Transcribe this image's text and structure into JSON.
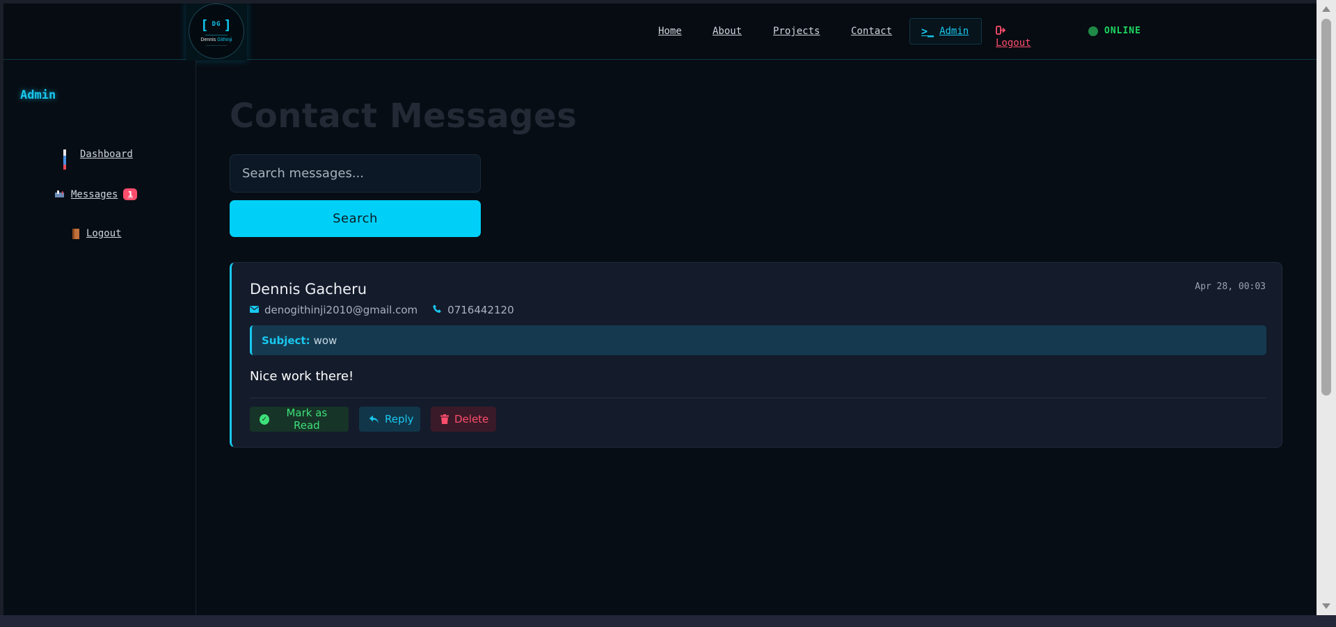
{
  "logo": {
    "initials": "DG",
    "name_first": "Dennis",
    "name_last": "Githinji"
  },
  "nav": {
    "home": "Home",
    "about": "About",
    "projects": "Projects",
    "contact": "Contact",
    "admin_prompt": ">_",
    "admin": "Admin",
    "logout": "Logout",
    "status": "ONLINE"
  },
  "sidebar": {
    "title": "Admin",
    "items": [
      {
        "label": "Dashboard",
        "icon": "bar-chart-icon"
      },
      {
        "label": "Messages",
        "icon": "mailbox-icon",
        "badge": "1"
      },
      {
        "label": "Logout",
        "icon": "door-icon"
      }
    ]
  },
  "main": {
    "title": "Contact Messages",
    "search": {
      "placeholder": "Search messages...",
      "button": "Search"
    },
    "messages": [
      {
        "name": "Dennis Gacheru",
        "date": "Apr 28, 00:03",
        "email": "denogithinji2010@gmail.com",
        "phone": "0716442120",
        "subject_label": "Subject:",
        "subject": "wow",
        "body": "Nice work there!",
        "actions": {
          "read": "Mark as Read",
          "reply": "Reply",
          "delete": "Delete"
        }
      }
    ]
  },
  "colors": {
    "accent": "#19c8ef",
    "danger": "#ff4d6d",
    "success": "#3ee07a",
    "background": "#070d14"
  }
}
